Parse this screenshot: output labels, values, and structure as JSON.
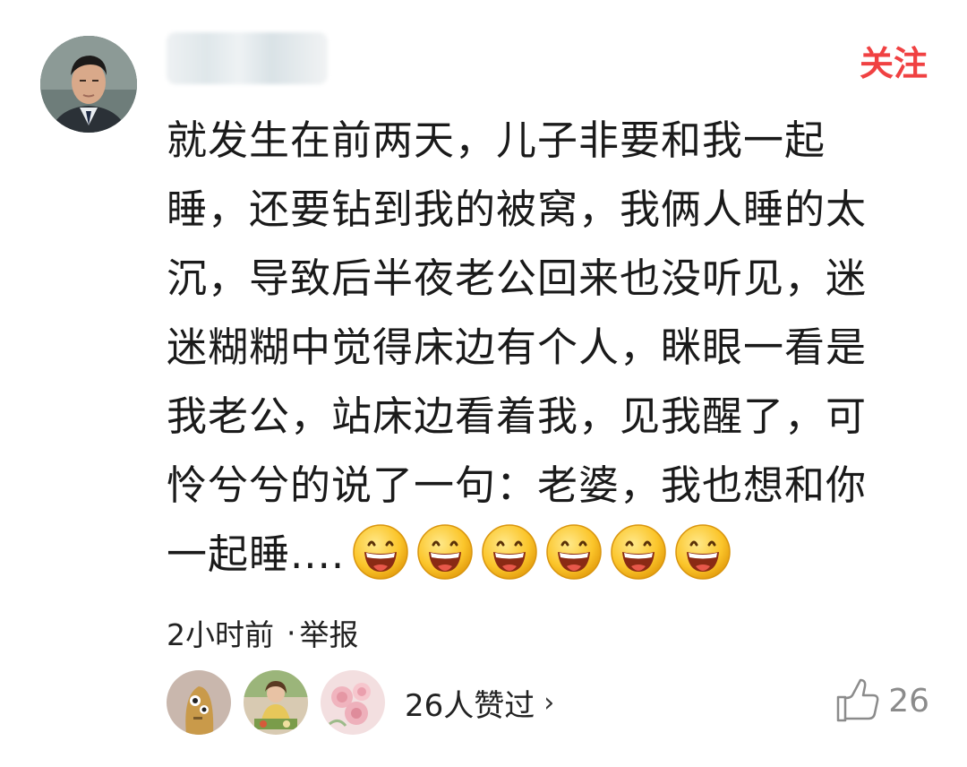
{
  "comment": {
    "follow_label": "关注",
    "text_lines": [
      "就发生在前两天，儿子非要和我一起",
      "睡，还要钻到我的被窝，我俩人睡的太",
      "沉，导致后半夜老公回来也没听见，迷",
      "迷糊糊中觉得床边有个人，眯眼一看是",
      "我老公，站床边看着我，见我醒了，可",
      "怜兮兮的说了一句：老婆，我也想和你"
    ],
    "last_line": "一起睡....",
    "emojis": [
      "grin-emoji",
      "grin-emoji",
      "grin-emoji",
      "grin-emoji",
      "grin-emoji",
      "grin-emoji"
    ],
    "time": "2小时前",
    "separator": "·",
    "report_label": "举报",
    "likers_summary": "26人赞过",
    "chevron": "›",
    "like_count": "26"
  },
  "colors": {
    "accent": "#f04142",
    "text": "#1a1a1a",
    "muted": "#8b8b8b"
  }
}
